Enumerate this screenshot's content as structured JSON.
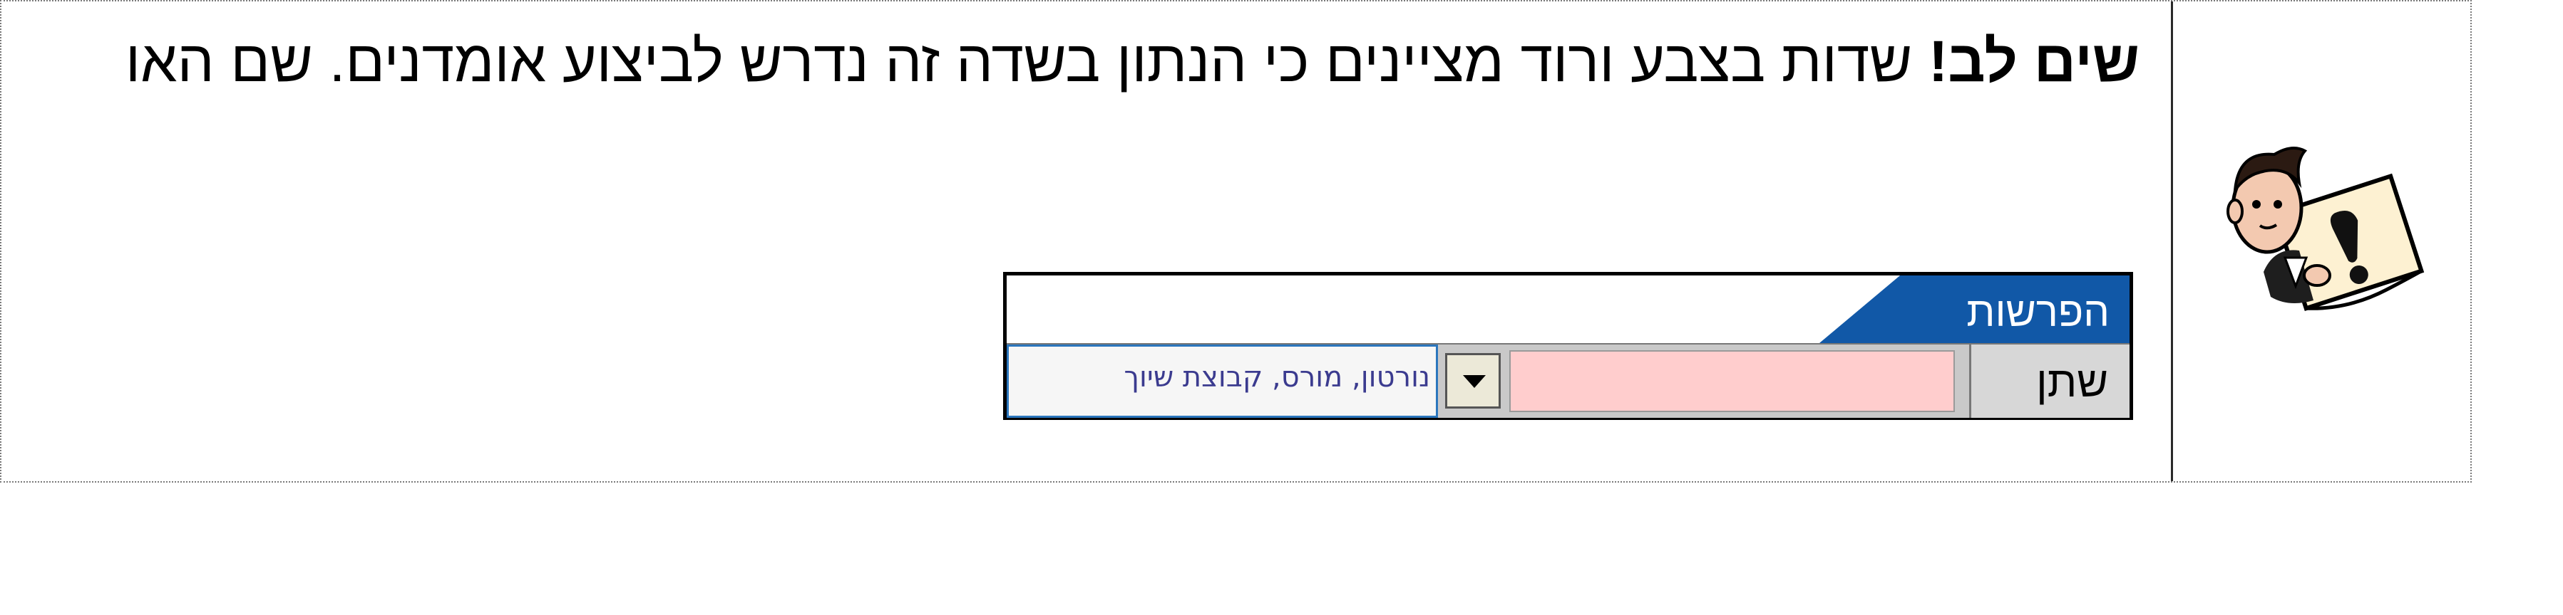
{
  "notice": {
    "bold": "שים לב!",
    "text": " שדות בצבע ורוד מציינים כי הנתון בשדה זה נדרש לביצוע אומדנים. שם האו"
  },
  "widget": {
    "title": "הפרשות",
    "field_label": "שתן",
    "hint": "נורטון,  מורס,  קבוצת שיוך"
  },
  "colors": {
    "header_blue": "#1158a7",
    "required_pink": "#ffcdcd"
  },
  "icons": [
    "cartoon-exclamation-icon",
    "dropdown-arrow-icon"
  ]
}
